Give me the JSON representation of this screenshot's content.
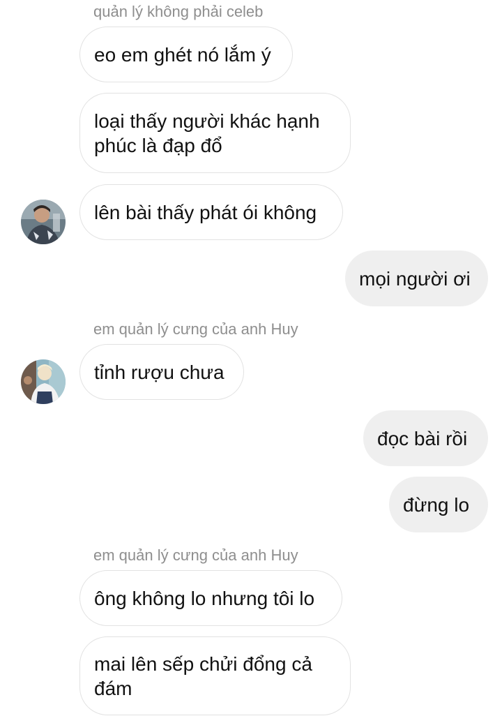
{
  "messages": {
    "sender_1": "quản lý không phải celeb",
    "m1": "eo em ghét nó lắm ý",
    "m2": "loại thấy người khác hạnh phúc là đạp đổ",
    "m3": "lên bài thấy phát ói không",
    "m4": "mọi người ơi",
    "sender_2": "em quản lý cưng của anh Huy",
    "m5": "tỉnh rượu chưa",
    "m6": "đọc bài rồi",
    "m7": "đừng lo",
    "sender_3": "em quản lý cưng của anh Huy",
    "m8": "ông không lo nhưng tôi lo",
    "m9": "mai lên sếp chửi đổng cả đám"
  },
  "avatars": {
    "a1": "profile-photo",
    "a2": "profile-photo"
  },
  "colors": {
    "incoming_border": "#e2e2e2",
    "outgoing_bg": "#efefef",
    "sender_text": "#8e8e8e"
  }
}
